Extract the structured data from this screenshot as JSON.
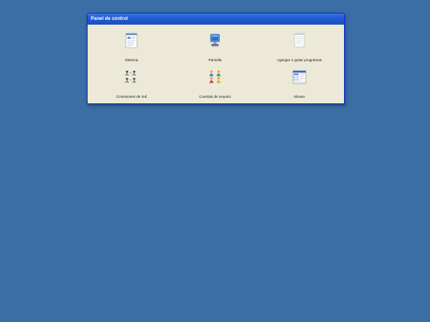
{
  "window": {
    "title": "Panel de control"
  },
  "items": [
    {
      "label": "Sistema",
      "icon": "system-icon"
    },
    {
      "label": "Pantalla",
      "icon": "display-icon"
    },
    {
      "label": "Agregar o quitar programas",
      "icon": "add-remove-programs-icon"
    },
    {
      "label": "Conexiones de red",
      "icon": "network-connections-icon"
    },
    {
      "label": "Cuentas de usuario",
      "icon": "user-accounts-icon"
    },
    {
      "label": "Mouse",
      "icon": "mouse-icon"
    }
  ],
  "colors": {
    "desktop": "#3a6ea5",
    "window_bg": "#ece9d8",
    "titlebar": "#245edb"
  }
}
